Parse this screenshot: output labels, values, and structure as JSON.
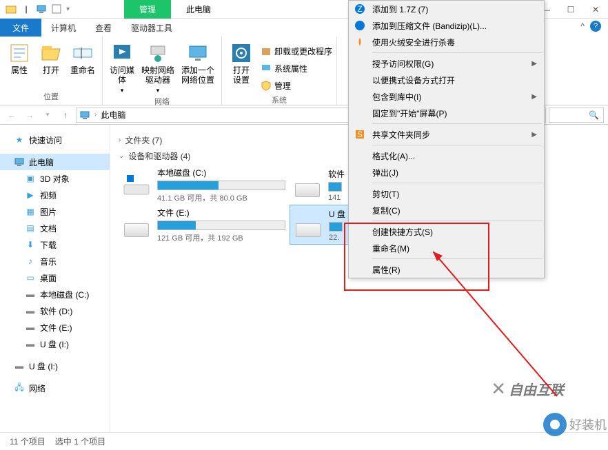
{
  "title_tabs": {
    "manage": "管理",
    "this_pc": "此电脑"
  },
  "ribbon_tabs": {
    "file": "文件",
    "computer": "计算机",
    "view": "查看",
    "drive_tools": "驱动器工具"
  },
  "ribbon": {
    "location": {
      "name": "位置",
      "properties": "属性",
      "open": "打开",
      "rename": "重命名"
    },
    "network": {
      "name": "网络",
      "access_media": "访问媒体",
      "map_drive": "映射网络\n驱动器",
      "add_location": "添加一个\n网络位置"
    },
    "system": {
      "name": "系统",
      "open_settings": "打开\n设置",
      "uninstall": "卸载或更改程序",
      "sys_props": "系统属性",
      "manage": "管理"
    }
  },
  "address": {
    "path": "此电脑"
  },
  "sidebar": {
    "quick": "快速访问",
    "this_pc": "此电脑",
    "items": [
      "3D 对象",
      "视频",
      "图片",
      "文档",
      "下载",
      "音乐",
      "桌面",
      "本地磁盘 (C:)",
      "软件 (D:)",
      "文件 (E:)",
      "U 盘 (I:)"
    ],
    "udisk2": "U 盘 (I:)",
    "network": "网络"
  },
  "main": {
    "folders_hdr": "文件夹 (7)",
    "drives_hdr": "设备和驱动器 (4)",
    "drives": [
      {
        "name": "本地磁盘 (C:)",
        "sub": "41.1 GB 可用，共 80.0 GB",
        "fill": 48
      },
      {
        "name": "软件",
        "sub": "141",
        "fill": 10
      },
      {
        "name": "文件 (E:)",
        "sub": "121 GB 可用，共 192 GB",
        "fill": 30
      },
      {
        "name": "U 盘",
        "sub": "22.",
        "fill": 10
      }
    ]
  },
  "context_menu": {
    "items": [
      {
        "label": "添加到 1.7Z (7)",
        "icon": "z7"
      },
      {
        "label": "添加到压缩文件 (Bandizip)(L)...",
        "icon": "bandizip"
      },
      {
        "label": "使用火绒安全进行杀毒",
        "icon": "huorong"
      }
    ],
    "group2": [
      {
        "label": "授予访问权限(G)",
        "arrow": true
      },
      {
        "label": "以便携式设备方式打开"
      },
      {
        "label": "包含到库中(I)",
        "arrow": true
      },
      {
        "label": "固定到\"开始\"屏幕(P)"
      }
    ],
    "sync": {
      "label": "共享文件夹同步",
      "icon": "sync",
      "arrow": true
    },
    "group3": [
      {
        "label": "格式化(A)..."
      },
      {
        "label": "弹出(J)"
      }
    ],
    "group4": [
      {
        "label": "剪切(T)"
      },
      {
        "label": "复制(C)"
      }
    ],
    "group5": [
      {
        "label": "创建快捷方式(S)"
      },
      {
        "label": "重命名(M)"
      }
    ],
    "properties": "属性(R)"
  },
  "status": {
    "count": "11 个项目",
    "selected": "选中 1 个项目"
  },
  "watermarks": {
    "w1": "自由互联",
    "w2": "好装机"
  }
}
